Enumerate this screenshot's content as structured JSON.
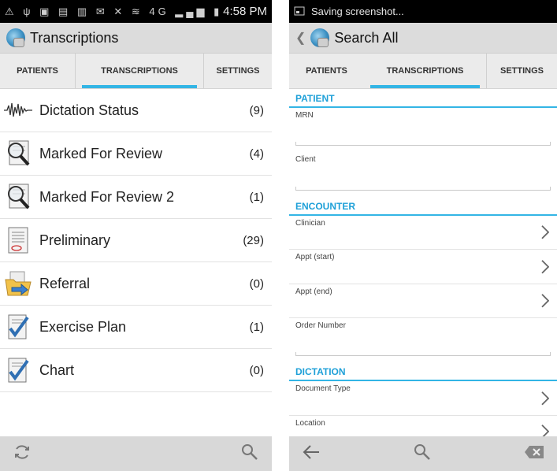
{
  "left": {
    "status": {
      "icons": "⚠ ψ ▣ ▤ ▥ ✉ ✕ ≋ 4G ▂▄▆ ▮",
      "time": "4:58 PM"
    },
    "title": "Transcriptions",
    "tabs": [
      {
        "label": "PATIENTS"
      },
      {
        "label": "TRANSCRIPTIONS"
      },
      {
        "label": "SETTINGS"
      }
    ],
    "items": [
      {
        "label": "Dictation Status",
        "count": "(9)",
        "icon": "waveform-icon"
      },
      {
        "label": "Marked For Review",
        "count": "(4)",
        "icon": "magnifier-document-icon"
      },
      {
        "label": "Marked For Review 2",
        "count": "(1)",
        "icon": "magnifier-document-icon"
      },
      {
        "label": "Preliminary",
        "count": "(29)",
        "icon": "document-icon"
      },
      {
        "label": "Referral",
        "count": "(0)",
        "icon": "folder-arrow-icon"
      },
      {
        "label": "Exercise Plan",
        "count": "(1)",
        "icon": "checklist-icon"
      },
      {
        "label": "Chart",
        "count": "(0)",
        "icon": "checklist-icon"
      }
    ]
  },
  "right": {
    "status": {
      "text": "Saving screenshot..."
    },
    "title": "Search All",
    "tabs": [
      {
        "label": "PATIENTS"
      },
      {
        "label": "TRANSCRIPTIONS"
      },
      {
        "label": "SETTINGS"
      }
    ],
    "sections": {
      "patient": {
        "title": "PATIENT",
        "fields": [
          {
            "label": "MRN"
          },
          {
            "label": "Client"
          }
        ]
      },
      "encounter": {
        "title": "ENCOUNTER",
        "fields": [
          {
            "label": "Clinician"
          },
          {
            "label": "Appt (start)"
          },
          {
            "label": "Appt (end)"
          },
          {
            "label": "Order Number"
          }
        ]
      },
      "dictation": {
        "title": "DICTATION",
        "fields": [
          {
            "label": "Document Type"
          },
          {
            "label": "Location"
          }
        ]
      }
    }
  },
  "colors": {
    "accent": "#33b5e5",
    "actionbar": "#dcdcdc",
    "tabbar": "#ebebeb"
  }
}
